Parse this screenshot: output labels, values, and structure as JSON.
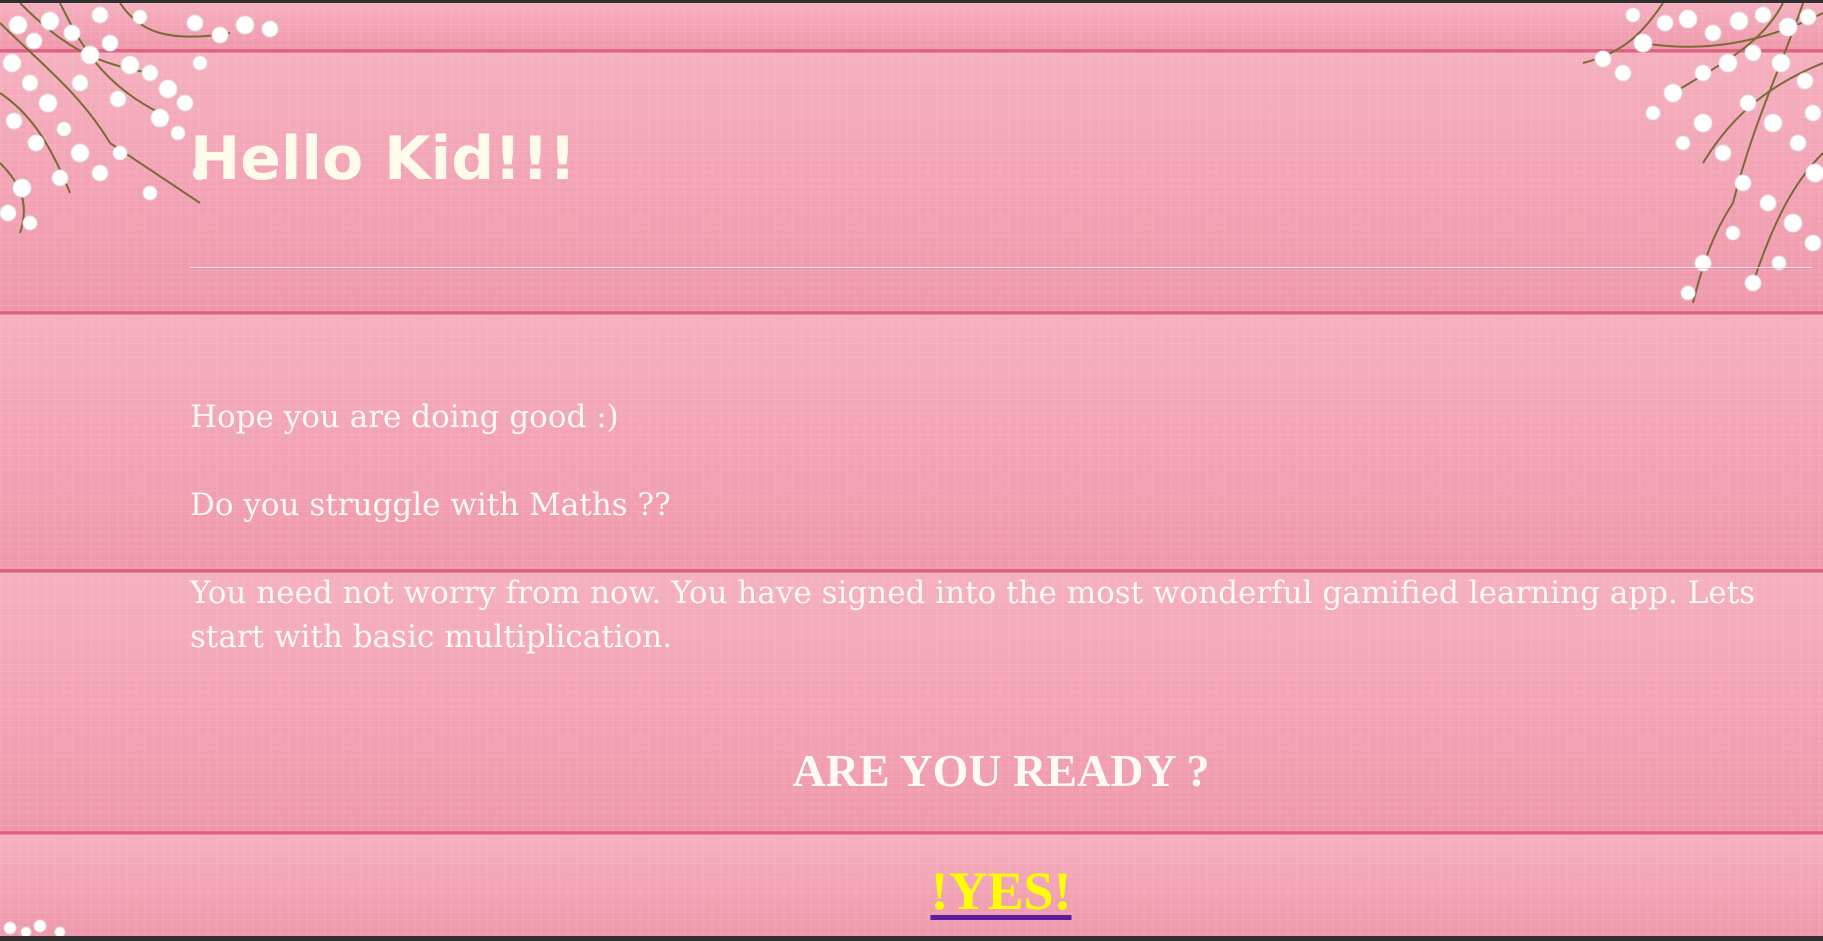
{
  "page": {
    "title": "Hello Kid!!!",
    "paragraphs": [
      "Hope you are doing good :)",
      "Do you struggle with Maths ??",
      "You need not worry from now. You have signed into the most wonderful gamified learning app. Lets start with basic multiplication."
    ],
    "ready_heading": "ARE YOU READY ?",
    "yes_link_label": "!YES!"
  },
  "colors": {
    "background_wood": "#f3a6b6",
    "title_text": "#fffbea",
    "body_text": "#fffaf3",
    "yes_link_text": "#ffff00",
    "yes_link_underline": "#5a1ca0"
  },
  "decorations": {
    "background": "pink-wood-planks-image",
    "corner_flowers": "white-baby-breath-flowers"
  }
}
